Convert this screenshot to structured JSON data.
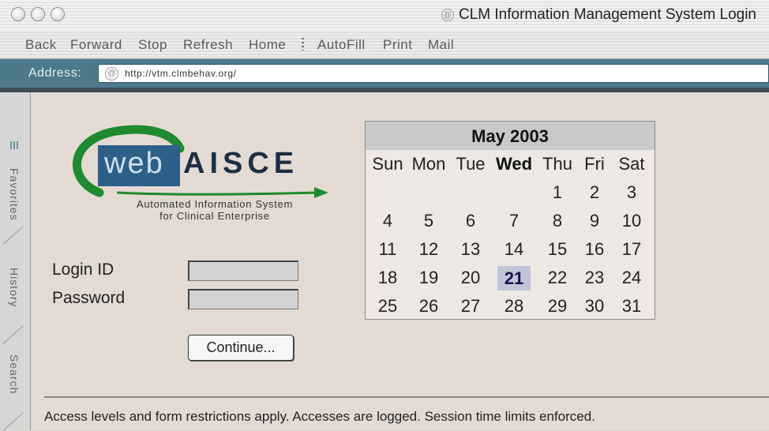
{
  "window": {
    "title": "CLM Information Management System Login"
  },
  "toolbar": {
    "back": "Back",
    "forward": "Forward",
    "stop": "Stop",
    "refresh": "Refresh",
    "home": "Home",
    "autofill": "AutoFill",
    "print": "Print",
    "mail": "Mail"
  },
  "address": {
    "label": "Address:",
    "url": "http://vtm.clmbehav.org/"
  },
  "sidebar": {
    "tabs": [
      "Favorites",
      "History",
      "Search"
    ]
  },
  "logo": {
    "web": "web",
    "brand": "AISCE",
    "tagline_line1": "Automated Information System",
    "tagline_line2": "for Clinical Enterprise"
  },
  "login": {
    "id_label": "Login ID",
    "password_label": "Password",
    "id_value": "",
    "password_value": "",
    "continue_label": "Continue..."
  },
  "calendar": {
    "title": "May 2003",
    "weekdays": [
      "Sun",
      "Mon",
      "Tue",
      "Wed",
      "Thu",
      "Fri",
      "Sat"
    ],
    "highlight_weekday": "Wed",
    "today": "21",
    "weeks": [
      [
        "",
        "",
        "",
        "",
        "1",
        "2",
        "3"
      ],
      [
        "4",
        "5",
        "6",
        "7",
        "8",
        "9",
        "10"
      ],
      [
        "11",
        "12",
        "13",
        "14",
        "15",
        "16",
        "17"
      ],
      [
        "18",
        "19",
        "20",
        "21",
        "22",
        "23",
        "24"
      ],
      [
        "25",
        "26",
        "27",
        "28",
        "29",
        "30",
        "31"
      ]
    ]
  },
  "footer": {
    "notice": "Access levels and form restrictions apply. Accesses are logged. Session time limits enforced."
  },
  "colors": {
    "address_bar": "#4c7a8a",
    "logo_blue": "#2d5f88",
    "logo_green": "#1f8a2f",
    "today_highlight": "#c2c4d8"
  }
}
